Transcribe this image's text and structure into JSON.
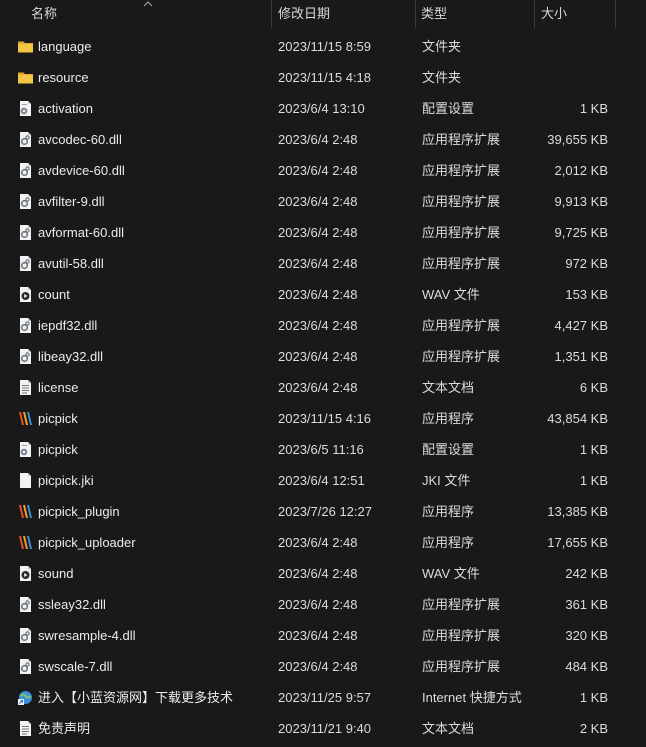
{
  "columns": {
    "name": "名称",
    "date": "修改日期",
    "type": "类型",
    "size": "大小"
  },
  "files": [
    {
      "name": "language",
      "date": "2023/11/15 8:59",
      "type": "文件夹",
      "size": "",
      "icon": "folder-icon"
    },
    {
      "name": "resource",
      "date": "2023/11/15 4:18",
      "type": "文件夹",
      "size": "",
      "icon": "folder-icon"
    },
    {
      "name": "activation",
      "date": "2023/6/4 13:10",
      "type": "配置设置",
      "size": "1 KB",
      "icon": "config-file-icon"
    },
    {
      "name": "avcodec-60.dll",
      "date": "2023/6/4 2:48",
      "type": "应用程序扩展",
      "size": "39,655 KB",
      "icon": "dll-file-icon"
    },
    {
      "name": "avdevice-60.dll",
      "date": "2023/6/4 2:48",
      "type": "应用程序扩展",
      "size": "2,012 KB",
      "icon": "dll-file-icon"
    },
    {
      "name": "avfilter-9.dll",
      "date": "2023/6/4 2:48",
      "type": "应用程序扩展",
      "size": "9,913 KB",
      "icon": "dll-file-icon"
    },
    {
      "name": "avformat-60.dll",
      "date": "2023/6/4 2:48",
      "type": "应用程序扩展",
      "size": "9,725 KB",
      "icon": "dll-file-icon"
    },
    {
      "name": "avutil-58.dll",
      "date": "2023/6/4 2:48",
      "type": "应用程序扩展",
      "size": "972 KB",
      "icon": "dll-file-icon"
    },
    {
      "name": "count",
      "date": "2023/6/4 2:48",
      "type": "WAV 文件",
      "size": "153 KB",
      "icon": "audio-file-icon"
    },
    {
      "name": "iepdf32.dll",
      "date": "2023/6/4 2:48",
      "type": "应用程序扩展",
      "size": "4,427 KB",
      "icon": "dll-file-icon"
    },
    {
      "name": "libeay32.dll",
      "date": "2023/6/4 2:48",
      "type": "应用程序扩展",
      "size": "1,351 KB",
      "icon": "dll-file-icon"
    },
    {
      "name": "license",
      "date": "2023/6/4 2:48",
      "type": "文本文档",
      "size": "6 KB",
      "icon": "text-file-icon"
    },
    {
      "name": "picpick",
      "date": "2023/11/15 4:16",
      "type": "应用程序",
      "size": "43,854 KB",
      "icon": "picpick-app-icon"
    },
    {
      "name": "picpick",
      "date": "2023/6/5 11:16",
      "type": "配置设置",
      "size": "1 KB",
      "icon": "config-file-icon"
    },
    {
      "name": "picpick.jki",
      "date": "2023/6/4 12:51",
      "type": "JKI 文件",
      "size": "1 KB",
      "icon": "blank-file-icon"
    },
    {
      "name": "picpick_plugin",
      "date": "2023/7/26 12:27",
      "type": "应用程序",
      "size": "13,385 KB",
      "icon": "picpick-app-icon"
    },
    {
      "name": "picpick_uploader",
      "date": "2023/6/4 2:48",
      "type": "应用程序",
      "size": "17,655 KB",
      "icon": "picpick-app-icon"
    },
    {
      "name": "sound",
      "date": "2023/6/4 2:48",
      "type": "WAV 文件",
      "size": "242 KB",
      "icon": "audio-file-icon"
    },
    {
      "name": "ssleay32.dll",
      "date": "2023/6/4 2:48",
      "type": "应用程序扩展",
      "size": "361 KB",
      "icon": "dll-file-icon"
    },
    {
      "name": "swresample-4.dll",
      "date": "2023/6/4 2:48",
      "type": "应用程序扩展",
      "size": "320 KB",
      "icon": "dll-file-icon"
    },
    {
      "name": "swscale-7.dll",
      "date": "2023/6/4 2:48",
      "type": "应用程序扩展",
      "size": "484 KB",
      "icon": "dll-file-icon"
    },
    {
      "name": "进入【小蓝资源网】下载更多技术",
      "date": "2023/11/25 9:57",
      "type": "Internet 快捷方式",
      "size": "1 KB",
      "icon": "internet-shortcut-icon"
    },
    {
      "name": "免责声明",
      "date": "2023/11/21 9:40",
      "type": "文本文档",
      "size": "2 KB",
      "icon": "text-file-icon"
    }
  ]
}
